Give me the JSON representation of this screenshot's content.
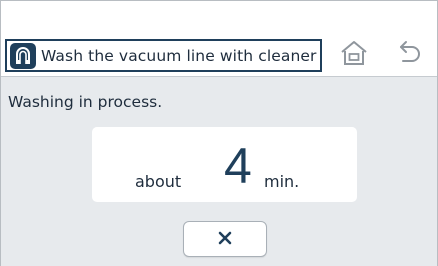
{
  "header": {
    "title": "Wash the vacuum line with cleaner",
    "title_icon": "vacuum-line-icon",
    "home_icon": "home-icon",
    "back_icon": "back-arrow-icon"
  },
  "main": {
    "status": "Washing in process.",
    "time": {
      "prefix": "about",
      "value": "4",
      "unit": "min."
    },
    "cancel_icon": "close-icon"
  },
  "colors": {
    "accent": "#1f3f5b",
    "content_background": "#e7eaed",
    "text": "#1f2d3d"
  }
}
